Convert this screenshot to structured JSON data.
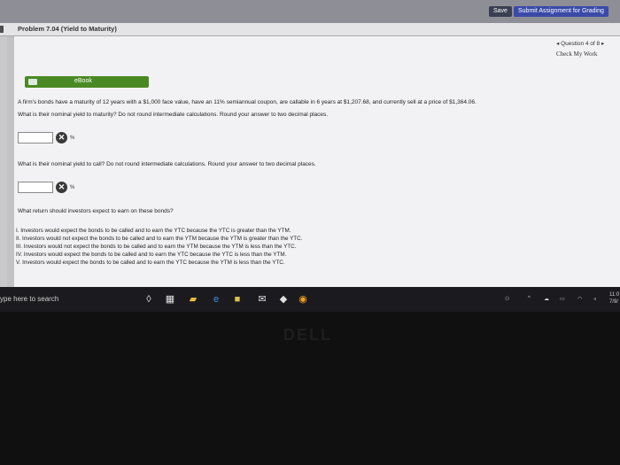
{
  "toolbar": {
    "save_label": "Save",
    "submit_label": "Submit Assignment for Grading"
  },
  "header": {
    "problem_title": "Problem 7.04 (Yield to Maturity)"
  },
  "nav": {
    "question_label": "◂ Question 4 of 8 ▸",
    "check_work_label": "Check My Work"
  },
  "ebook": {
    "label": "eBook"
  },
  "question": {
    "line1": "A firm's bonds have a maturity of 12 years with a $1,000 face value, have an 11% semiannual coupon, are callable in 6 years at $1,207.68, and currently sell at a price of $1,364.06.",
    "line2": "What is their nominal yield to maturity? Do not round intermediate calculations. Round your answer to two decimal places.",
    "unit_percent": "%",
    "ytc_prompt": "What is their nominal yield to call? Do not round intermediate calculations. Round your answer to two decimal places.",
    "return_prompt": "What return should investors expect to earn on these bonds?",
    "options": [
      "I. Investors would expect the bonds to be called and to earn the YTC because the YTC is greater than the YTM.",
      "II. Investors would not expect the bonds to be called and to earn the YTM because the YTM is greater than the YTC.",
      "III. Investors would not expect the bonds to be called and to earn the YTM because the YTM is less than the YTC.",
      "IV. Investors would expect the bonds to be called and to earn the YTC because the YTC is less than the YTM.",
      "V. Investors would expect the bonds to be called and to earn the YTC because the YTM is less than the YTC."
    ]
  },
  "taskbar": {
    "search_text": "ype here to search",
    "time": "11:0",
    "date": "7/9/"
  },
  "device": {
    "brand": "DELL"
  },
  "colors": {
    "ebook_green": "#4a8a24",
    "submit_blue": "#3a4aa8",
    "taskbar_bg": "#1b1b1f"
  }
}
